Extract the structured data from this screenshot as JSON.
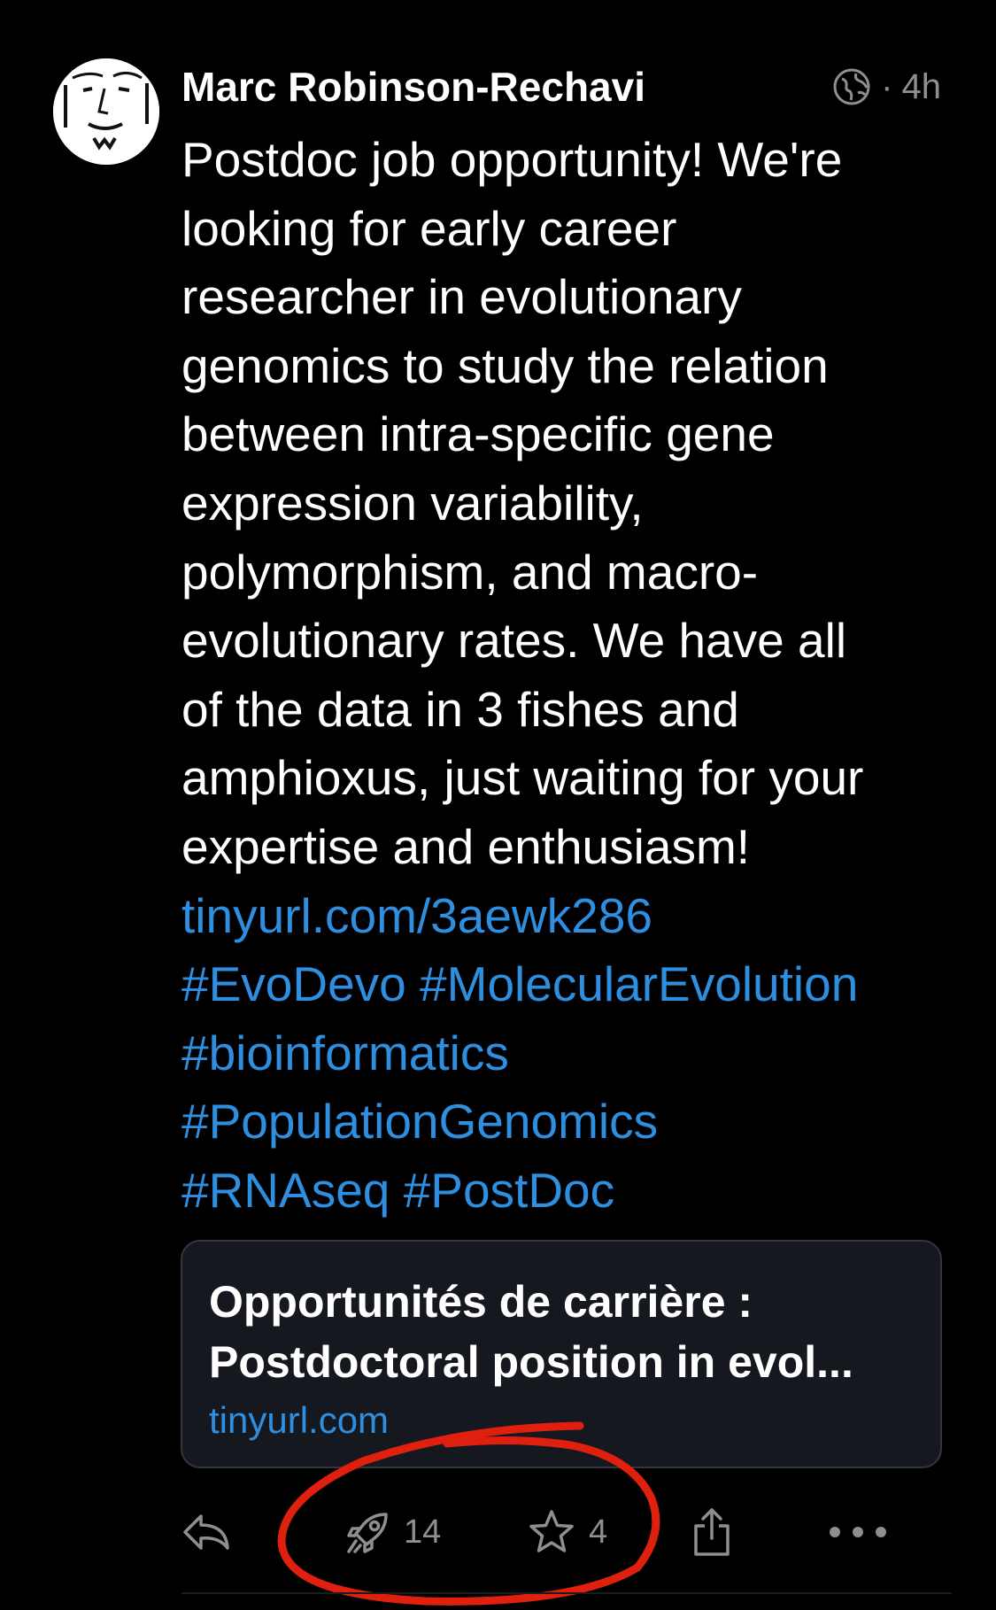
{
  "post": {
    "author": "Marc Robinson-Rechavi",
    "visibility_icon": "globe-icon",
    "separator": "·",
    "time": "4h",
    "body_lines": [
      "Postdoc job opportunity! We're",
      "looking for early career",
      "researcher in evolutionary",
      "genomics to study the relation",
      "between intra-specific gene",
      "expression variability,",
      "polymorphism, and macro-",
      "evolutionary rates. We have all",
      "of the data in 3 fishes and",
      "amphioxus, just waiting for your",
      "expertise and enthusiasm!"
    ],
    "link": "tinyurl.com/3aewk286",
    "hashtags": {
      "evodevo": "#EvoDevo",
      "molecular_evolution": "#MolecularEvolution",
      "bioinformatics": "#bioinformatics",
      "population_genomics": "#PopulationGenomics",
      "rnaseq": "#RNAseq",
      "postdoc": "#PostDoc"
    }
  },
  "card": {
    "title_line1": "Opportunités de carrière :",
    "title_line2": "Postdoctoral position in evol...",
    "domain": "tinyurl.com"
  },
  "actions": {
    "reply_icon": "reply-icon",
    "boost_icon": "rocket-icon",
    "boost_count": "14",
    "favourite_icon": "star-icon",
    "favourite_count": "4",
    "share_icon": "share-icon",
    "more_icon": "more-icon"
  },
  "colors": {
    "background": "#000000",
    "text": "#ffffff",
    "muted": "#8e8e93",
    "link": "#2e8fe0",
    "card_background": "#16181f",
    "highlight_circle": "#e0200f"
  }
}
